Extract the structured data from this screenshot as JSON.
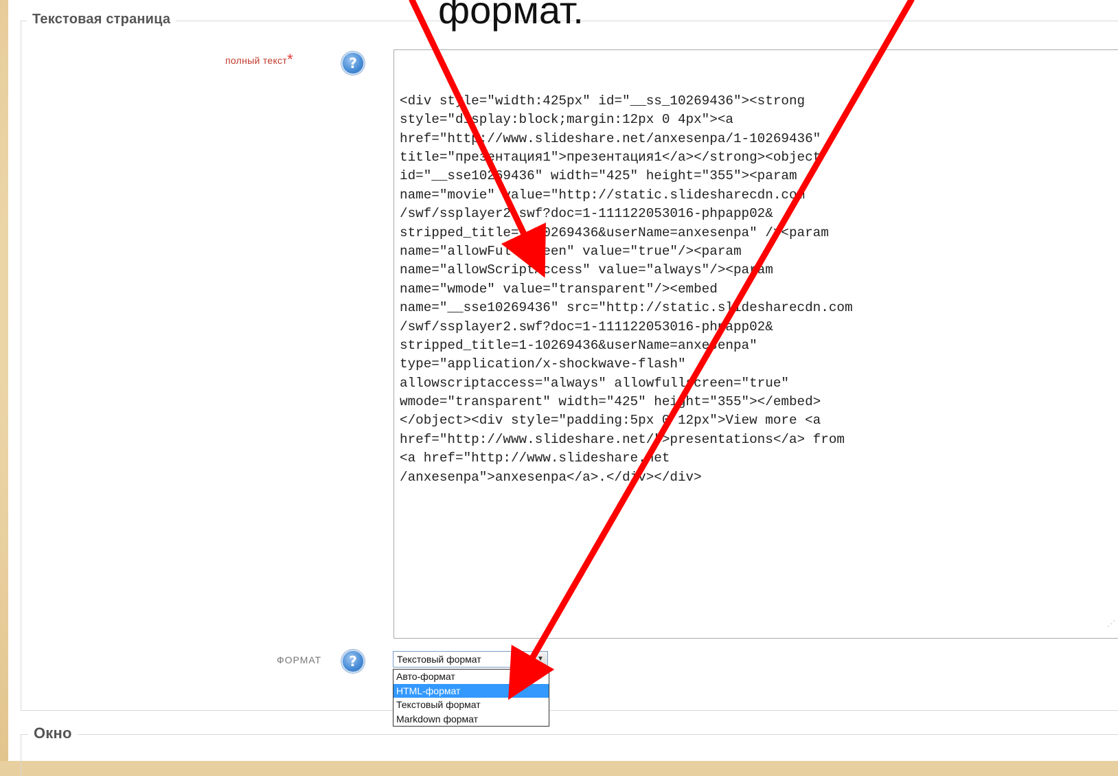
{
  "slide": {
    "caption": "формат."
  },
  "text_page_group": {
    "legend": "Текстовая страница",
    "full_text_label": "полный текст",
    "required_mark": "*",
    "help_icon": "question-mark-icon",
    "full_text_lines": [
      "<div style=\"width:425px\" id=\"__ss_10269436\"><strong",
      "style=\"display:block;margin:12px 0 4px\"><a",
      "href=\"http://www.slideshare.net/anxesenpa/1-10269436\"",
      "title=\"презентация1\">презентация1</a></strong><object",
      "id=\"__sse10269436\" width=\"425\" height=\"355\"><param",
      "name=\"movie\" value=\"http://static.slidesharecdn.com",
      "/swf/ssplayer2.swf?doc=1-111122053016-phpapp02&",
      "stripped_title=1-10269436&userName=anxesenpa\" /><param",
      "name=\"allowFullScreen\" value=\"true\"/><param",
      "name=\"allowScriptAccess\" value=\"always\"/><param",
      "name=\"wmode\" value=\"transparent\"/><embed",
      "name=\"__sse10269436\" src=\"http://static.slidesharecdn.com",
      "/swf/ssplayer2.swf?doc=1-111122053016-phpapp02&",
      "stripped_title=1-10269436&userName=anxesenpa\"",
      "type=\"application/x-shockwave-flash\"",
      "allowscriptaccess=\"always\" allowfullscreen=\"true\"",
      "wmode=\"transparent\" width=\"425\" height=\"355\"></embed>",
      "</object><div style=\"padding:5px 0 12px\">View more <a",
      "href=\"http://www.slideshare.net/\">presentations</a> from",
      "<a href=\"http://www.slideshare.net",
      "/anxesenpa\">anxesenpa</a>.</div></div>"
    ],
    "format_label": "ФОРМАТ",
    "format_select_value": "Текстовый формат",
    "format_options": [
      "Авто-формат",
      "HTML-формат",
      "Текстовый формат",
      "Markdown формат"
    ],
    "highlighted_option_index": 1
  },
  "window_group": {
    "legend": "Окно"
  },
  "colors": {
    "arrow": "#ff0000",
    "option_highlight": "#3399ff",
    "required_label": "#c0392b",
    "slide_background": "#f3e2bd"
  }
}
